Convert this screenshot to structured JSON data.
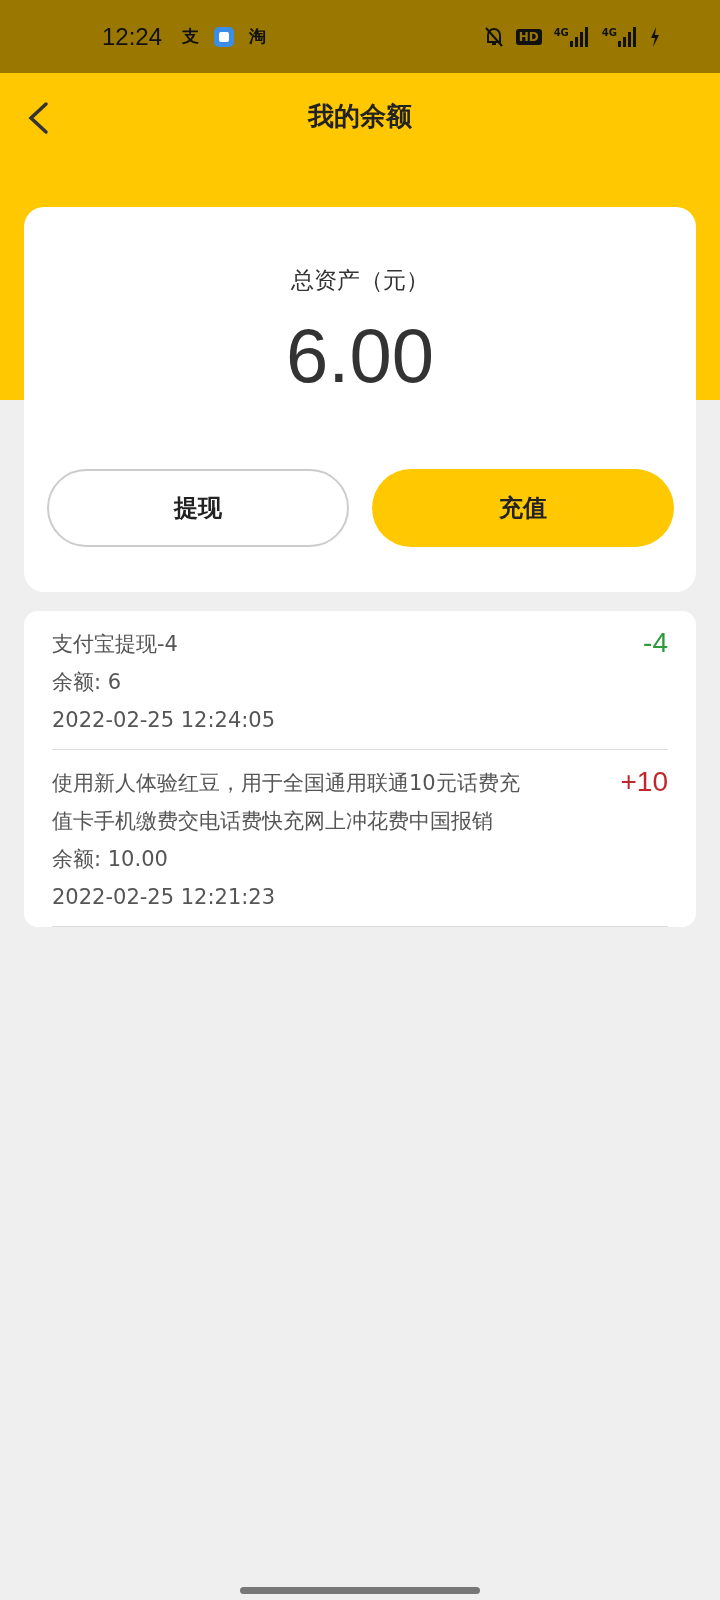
{
  "status_bar": {
    "time": "12:24",
    "notification_icons": [
      "支",
      "淘"
    ],
    "hd": "HD",
    "networks": [
      "4G",
      "4G"
    ]
  },
  "header": {
    "title": "我的余额"
  },
  "summary": {
    "label": "总资产（元）",
    "amount": "6.00"
  },
  "buttons": [
    {
      "label": "提现",
      "kind": "outline"
    },
    {
      "label": "充值",
      "kind": "filled"
    }
  ],
  "transactions": [
    {
      "title": "支付宝提现-4",
      "amount": "-4",
      "kind": "expense",
      "balance": "余额: 6",
      "time": "2022-02-25 12:24:05"
    },
    {
      "title": "使用新人体验红豆，用于全国通用联通10元话费充值卡手机缴费交电话费快充网上冲花费中国报销",
      "amount": "+10",
      "kind": "income",
      "balance": "余额: 10.00",
      "time": "2022-02-25 12:21:23"
    }
  ]
}
